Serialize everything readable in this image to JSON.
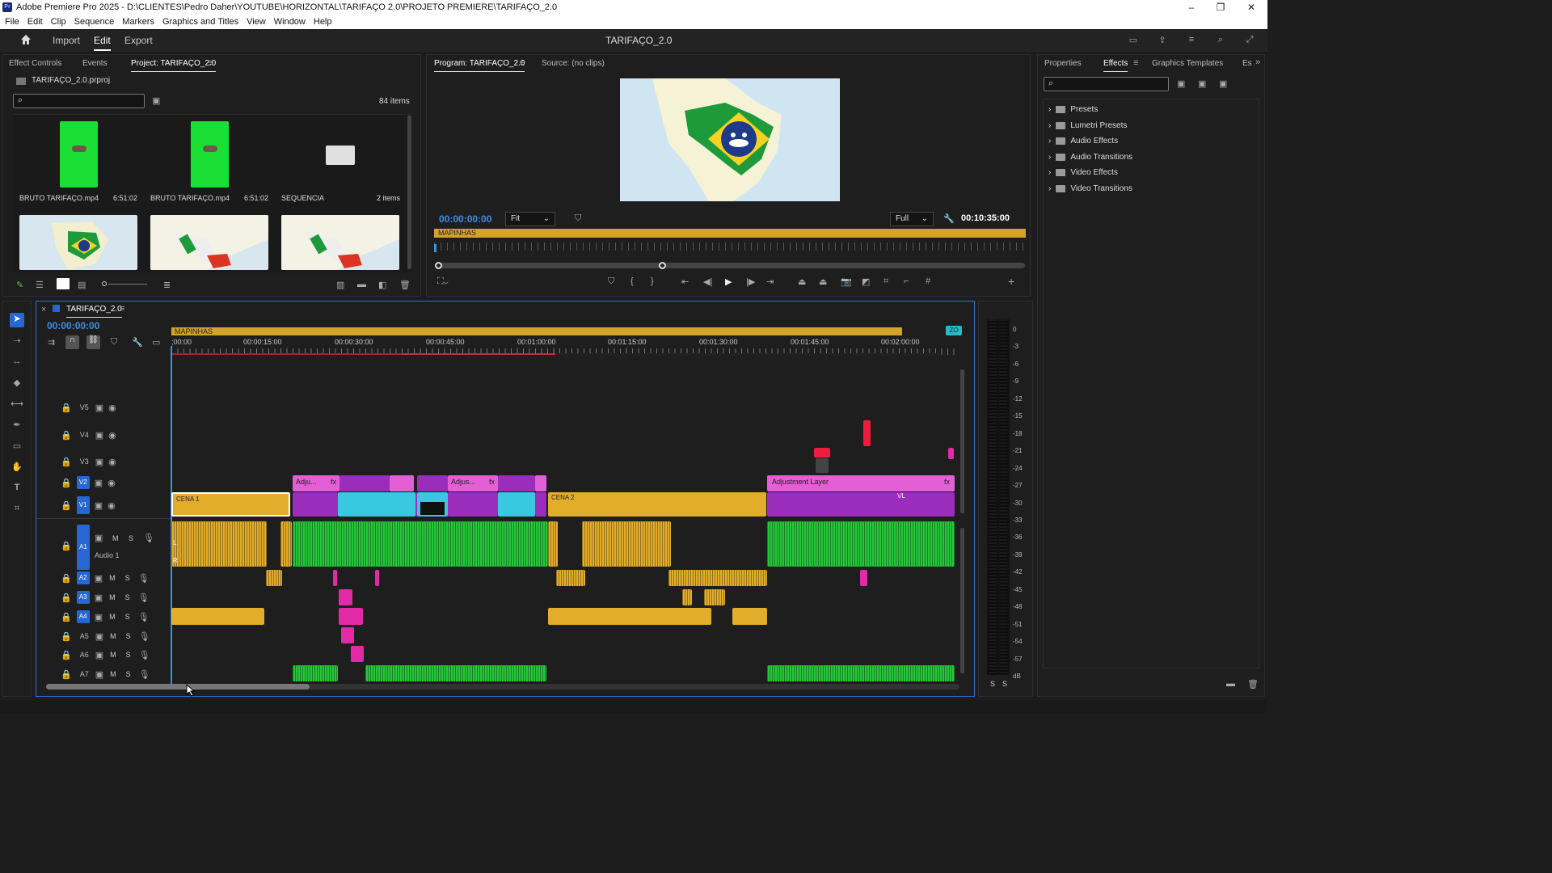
{
  "window": {
    "title": "Adobe Premiere Pro 2025 - D:\\CLIENTES\\Pedro Daher\\YOUTUBE\\HORIZONTAL\\TARIFAÇO 2.0\\PROJETO PREMIERE\\TARIFAÇO_2.0",
    "app_icon": "Pr",
    "minimize": "–",
    "maximize": "❐",
    "close": "✕"
  },
  "menu": [
    "File",
    "Edit",
    "Clip",
    "Sequence",
    "Markers",
    "Graphics and Titles",
    "View",
    "Window",
    "Help"
  ],
  "workspace": {
    "import": "Import",
    "edit": "Edit",
    "export": "Export",
    "project_title": "TARIFAÇO_2.0"
  },
  "project": {
    "tabs": [
      "Effect Controls",
      "Events",
      "Project: TARIFAÇO_2.0"
    ],
    "file": "TARIFAÇO_2.0.prproj",
    "items_count": "84 items",
    "bins": [
      {
        "name": "BRUTO TARIFAÇO.mp4",
        "duration": "6:51:02"
      },
      {
        "name": "BRUTO TARIFAÇO.mp4",
        "duration": "6:51:02"
      },
      {
        "name": "SEQUENCIA",
        "duration": "2 items"
      }
    ]
  },
  "program": {
    "tab": "Program: TARIFAÇO_2.0",
    "source": "Source: (no clips)",
    "timecode": "00:00:00:00",
    "fit": "Fit",
    "quality": "Full",
    "duration": "00:10:35:00",
    "marker": "MAPINHAS"
  },
  "effects": {
    "tabs": [
      "Properties",
      "Effects",
      "Graphics Templates",
      "Es"
    ],
    "items": [
      "Presets",
      "Lumetri Presets",
      "Audio Effects",
      "Audio Transitions",
      "Video Effects",
      "Video Transitions"
    ]
  },
  "timeline": {
    "tab": "TARIFAÇO_2.0",
    "timecode": "00:00:00:00",
    "marker": "MAPINHAS",
    "ruler": [
      ";00:00",
      "00:00:15:00",
      "00:00:30:00",
      "00:00:45:00",
      "00:01:00:00",
      "00:01:15:00",
      "00:01:30:00",
      "00:01:45:00",
      "00:02:00:00"
    ],
    "video_tracks": [
      "V5",
      "V4",
      "V3",
      "V2",
      "V1"
    ],
    "audio_tracks": [
      "A1",
      "A2",
      "A3",
      "A4",
      "A5",
      "A6",
      "A7"
    ],
    "audio1_name": "Audio 1",
    "clip_labels": {
      "cena1": "CENA 1",
      "cena2": "CENA 2",
      "adj1": "Adju...",
      "adj2": "Adjus...",
      "adj3": "Adjustment Layer",
      "vl": "VL",
      "fx": "fx",
      "l": "L",
      "r": "R",
      "zoom_tag": "ZO"
    },
    "btn_m": "M",
    "btn_s": "S"
  },
  "meter": {
    "scale": [
      "0",
      "-3",
      "-6",
      "-9",
      "-12",
      "-15",
      "-18",
      "-21",
      "-24",
      "-27",
      "-30",
      "-33",
      "-36",
      "-39",
      "-42",
      "-45",
      "-48",
      "-51",
      "-54",
      "-57",
      "dB"
    ],
    "solo": "S"
  }
}
